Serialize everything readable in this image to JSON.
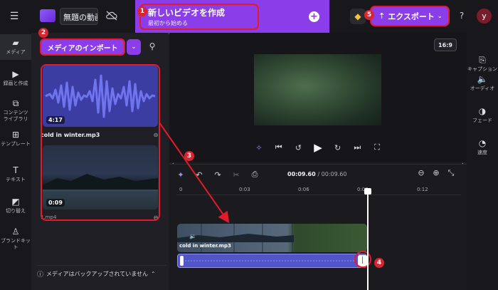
{
  "topbar": {
    "project_title": "無題の動画",
    "new_video": {
      "title": "新しいビデオを作成",
      "subtitle": "最初から始める"
    },
    "export_label": "エクスポート",
    "help": "?",
    "avatar_letter": "y"
  },
  "rail": {
    "items": [
      {
        "label": "メディア",
        "icon": "folder-icon"
      },
      {
        "label": "録画と作成",
        "icon": "record-icon"
      },
      {
        "label": "コンテンツライブラリ",
        "icon": "library-icon"
      },
      {
        "label": "テンプレート",
        "icon": "template-icon"
      },
      {
        "label": "テキスト",
        "icon": "text-icon"
      },
      {
        "label": "切り替え",
        "icon": "transition-icon"
      },
      {
        "label": "ブランドキット",
        "icon": "brand-icon"
      }
    ]
  },
  "media": {
    "import_label": "メディアのインポート",
    "audio": {
      "duration": "4:17",
      "name": "cold in winter.mp3"
    },
    "video": {
      "duration": "0:09",
      "name": "1.mp4"
    },
    "backup_notice": "メディアはバックアップされていません"
  },
  "preview": {
    "ratio": "16:9"
  },
  "right_rail": {
    "items": [
      {
        "label": "キャプション",
        "icon": "caption-icon"
      },
      {
        "label": "オーディオ",
        "icon": "audio-icon"
      },
      {
        "label": "フェード",
        "icon": "fade-icon"
      },
      {
        "label": "速度",
        "icon": "speed-icon"
      }
    ]
  },
  "timeline": {
    "current_time": "00:09.60",
    "total_time": "/ 00:09.60",
    "ruler": [
      "0",
      "0:03",
      "0:06",
      "0:09",
      "0:12"
    ],
    "video_clip_label": "cold in winter.mp3"
  },
  "markers": [
    "1",
    "2",
    "3",
    "4",
    "5"
  ],
  "colors": {
    "accent": "#8c3dea",
    "annotation": "#e21b2b",
    "audio_track": "#5155c8"
  }
}
